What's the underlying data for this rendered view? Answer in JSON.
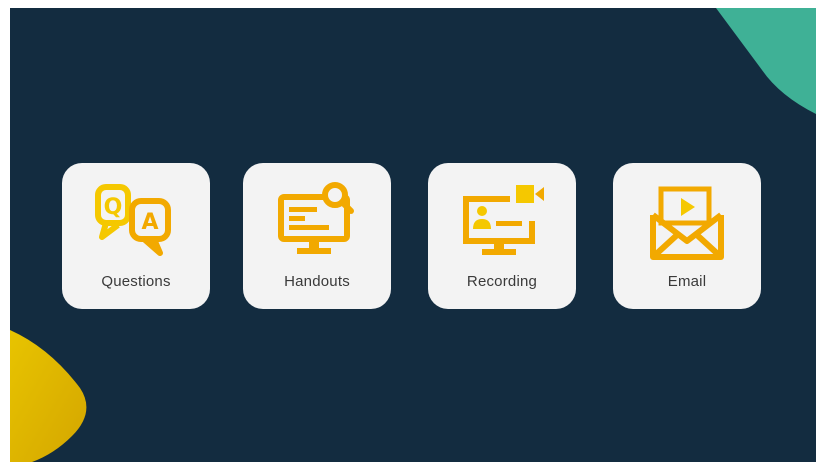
{
  "tiles": [
    {
      "label": "Questions",
      "icon": "qa-chat-icon"
    },
    {
      "label": "Handouts",
      "icon": "monitor-search-icon"
    },
    {
      "label": "Recording",
      "icon": "monitor-video-icon"
    },
    {
      "label": "Email",
      "icon": "envelope-play-icon"
    }
  ],
  "colors": {
    "background": "#132c40",
    "tile": "#f3f3f3",
    "icon_gold": "#f2a900",
    "icon_yellow": "#f5c800",
    "accent_teal": "#3fb196",
    "accent_yellow": "#e2bb00"
  }
}
